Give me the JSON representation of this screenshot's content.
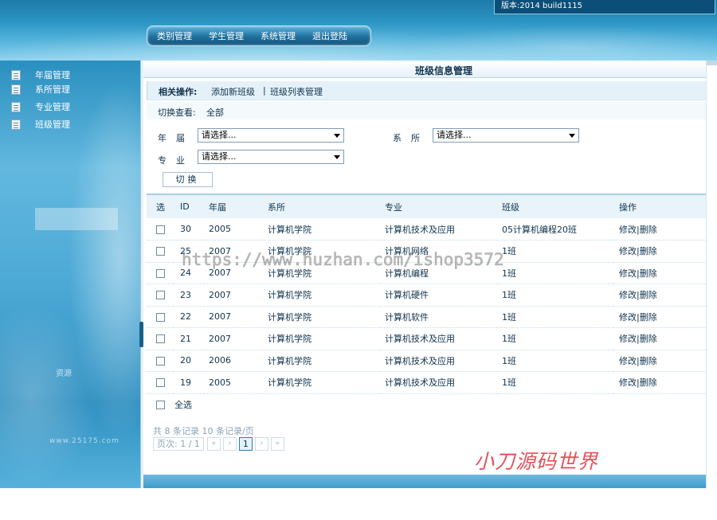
{
  "header": {
    "version": "版本:2014 build1115",
    "nav": [
      "类别管理",
      "学生管理",
      "系统管理",
      "退出登陆"
    ]
  },
  "sidebar": {
    "items": [
      "年届管理",
      "系所管理",
      "专业管理",
      "班级管理"
    ],
    "faint_text": "资源",
    "url_text": "www.25175.com"
  },
  "main": {
    "title": "班级信息管理",
    "ops_label": "相关操作:",
    "ops_links": [
      "添加新班级",
      "班级列表管理"
    ],
    "ops_sep": "|",
    "switch_label": "切换查看:",
    "switch_value": "全部",
    "filters": {
      "year_label": "年届",
      "dept_label": "系所",
      "major_label": "专业",
      "year_value": "请选择...",
      "dept_value": "请选择...",
      "major_value": "请选择...",
      "switch_button": "切换"
    },
    "table": {
      "headers": [
        "选",
        "ID",
        "年届",
        "系所",
        "专业",
        "班级",
        "操作"
      ],
      "rows": [
        {
          "id": "30",
          "year": "2005",
          "dept": "计算机学院",
          "major": "计算机技术及应用",
          "cls": "05计算机编程20班"
        },
        {
          "id": "25",
          "year": "2007",
          "dept": "计算机学院",
          "major": "计算机网络",
          "cls": "1班"
        },
        {
          "id": "24",
          "year": "2007",
          "dept": "计算机学院",
          "major": "计算机编程",
          "cls": "1班"
        },
        {
          "id": "23",
          "year": "2007",
          "dept": "计算机学院",
          "major": "计算机硬件",
          "cls": "1班"
        },
        {
          "id": "22",
          "year": "2007",
          "dept": "计算机学院",
          "major": "计算机软件",
          "cls": "1班"
        },
        {
          "id": "21",
          "year": "2007",
          "dept": "计算机学院",
          "major": "计算机技术及应用",
          "cls": "1班"
        },
        {
          "id": "20",
          "year": "2006",
          "dept": "计算机学院",
          "major": "计算机技术及应用",
          "cls": "1班"
        },
        {
          "id": "19",
          "year": "2005",
          "dept": "计算机学院",
          "major": "计算机技术及应用",
          "cls": "1班"
        }
      ],
      "edit_label": "修改",
      "action_sep": "|",
      "delete_label": "删除"
    },
    "select_all": "全选",
    "records": "共 8 条记录  10 条记录/页",
    "pager": {
      "info": "页次: 1 / 1",
      "first": "«",
      "prev": "‹",
      "current": "1",
      "next": "›",
      "last": "»"
    }
  },
  "overlay": {
    "url_watermark": "https://www.huzhan.com/ishop3572",
    "brand_watermark": "小刀源码世界"
  }
}
